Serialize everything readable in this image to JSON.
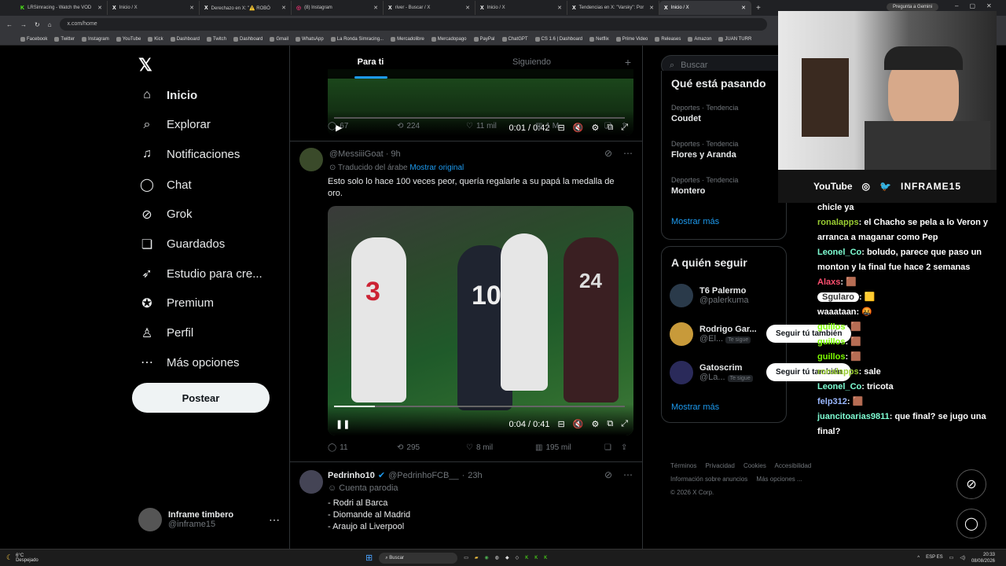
{
  "browser": {
    "tabs": [
      {
        "label": "LRSimracing - Watch the VOD",
        "icon": "K",
        "color": "#53fc18",
        "active": false
      },
      {
        "label": "Inicio / X",
        "icon": "X",
        "color": "#fff",
        "active": false
      },
      {
        "label": "Derechazo en X: \"⚠️ ROBÓ",
        "icon": "X",
        "color": "#fff",
        "active": false
      },
      {
        "label": "(8) Instagram",
        "icon": "◎",
        "color": "#e1306c",
        "active": false
      },
      {
        "label": "river - Buscar / X",
        "icon": "X",
        "color": "#fff",
        "active": false
      },
      {
        "label": "Inicio / X",
        "icon": "X",
        "color": "#fff",
        "active": false
      },
      {
        "label": "Tendencias en X: \"Varsky\": Por",
        "icon": "X",
        "color": "#fff",
        "active": false
      },
      {
        "label": "Inicio / X",
        "icon": "X",
        "color": "#fff",
        "active": true
      }
    ],
    "gemini": "Pregunta a Gemini",
    "url": "x.com/home",
    "bookmarks": [
      "Facebook",
      "Twitter",
      "Instagram",
      "YouTube",
      "Kick",
      "Dashboard",
      "Twitch",
      "Dashboard",
      "Gmail",
      "WhatsApp",
      "La Ronda Simracing...",
      "Mercadolibre",
      "Mercadopago",
      "PayPal",
      "ChatGPT",
      "CS 1.6 | Dashboard",
      "Netflix",
      "Prime Video",
      "Releases",
      "Amazon",
      "JUAN TURR"
    ]
  },
  "nav": {
    "items": [
      {
        "label": "Inicio",
        "icon": "⌂",
        "name": "home",
        "bold": true
      },
      {
        "label": "Explorar",
        "icon": "⌕",
        "name": "explore"
      },
      {
        "label": "Notificaciones",
        "icon": "♫",
        "name": "notifications"
      },
      {
        "label": "Chat",
        "icon": "◯",
        "name": "chat"
      },
      {
        "label": "Grok",
        "icon": "⊘",
        "name": "grok"
      },
      {
        "label": "Guardados",
        "icon": "❏",
        "name": "bookmarks"
      },
      {
        "label": "Estudio para cre...",
        "icon": "➶",
        "name": "creator-studio"
      },
      {
        "label": "Premium",
        "icon": "✪",
        "name": "premium"
      },
      {
        "label": "Perfil",
        "icon": "♙",
        "name": "profile"
      },
      {
        "label": "Más opciones",
        "icon": "⋯",
        "name": "more"
      }
    ],
    "post_label": "Postear",
    "account": {
      "name": "Inframe timbero",
      "handle": "@inframe15"
    }
  },
  "feed": {
    "tabs": [
      "Para ti",
      "Siguiendo"
    ],
    "tweet1": {
      "video_time": "0:01 / 0:42",
      "replies": "67",
      "reposts": "224",
      "likes": "11 mil",
      "views": "1 M"
    },
    "tweet2": {
      "handle": "@MessiiiGoat",
      "time": "9h",
      "translated": "Traducido del árabe",
      "show_original": "Mostrar original",
      "text": "Esto solo lo hace 100 veces peor, quería regalarle a su papá la medalla de oro.",
      "video_time": "0:04 / 0:41",
      "replies": "11",
      "reposts": "295",
      "likes": "8 mil",
      "views": "195 mil"
    },
    "tweet3": {
      "name": "Pedrinho10",
      "handle": "@PedrinhoFCB__",
      "time": "23h",
      "badge": "Cuenta parodia",
      "lines": [
        "- Rodri al Barca",
        "- Diomande al Madrid",
        "- Araujo al Liverpool"
      ]
    }
  },
  "right": {
    "search_placeholder": "Buscar",
    "trends_title": "Qué está pasando",
    "trends": [
      {
        "cat": "Deportes · Tendencia",
        "name": "Coudet"
      },
      {
        "cat": "Deportes · Tendencia",
        "name": "Flores y Aranda"
      },
      {
        "cat": "Deportes · Tendencia",
        "name": "Montero"
      }
    ],
    "show_more": "Mostrar más",
    "wtf_title": "A quién seguir",
    "wtf": [
      {
        "name": "T6 Palermo",
        "handle": "@palerkuma",
        "follows_you": ""
      },
      {
        "name": "Rodrigo Gar...",
        "handle": "@El...",
        "follows_you": "Te sigue",
        "button": "Seguir tú también"
      },
      {
        "name": "Gatoscrim",
        "handle": "@La...",
        "follows_you": "Te sigue",
        "button": "Seguir tú también"
      }
    ],
    "footer": [
      "Términos",
      "Privacidad",
      "Cookies",
      "Accesibilidad",
      "Información sobre anuncios",
      "Más opciones ...",
      "© 2026 X Corp."
    ]
  },
  "stream": {
    "socials": [
      "YouTube",
      "◎",
      "🐦",
      "INFRAME15"
    ],
    "chat": [
      {
        "user": "",
        "msg": "chicle ya",
        "color": "#fff"
      },
      {
        "user": "ronalapps",
        "msg": ": el Chacho se pela a lo Veron y arranca a maganar como Pep",
        "color": "#9acd32"
      },
      {
        "user": "Leonel_Co",
        "msg": ": boludo, parece que paso un monton y la final fue hace 2 semanas",
        "color": "#7fffd4"
      },
      {
        "user": "Alaxs",
        "msg": ": 🟫",
        "color": "#ff4f6f"
      },
      {
        "user": "Sgularo",
        "msg": ": 🟨",
        "color": "#333"
      },
      {
        "user": "waaataan",
        "msg": ": 🤬",
        "color": "#fff"
      },
      {
        "user": "guillos",
        "msg": ": 🟫",
        "color": "#7cfc00"
      },
      {
        "user": "guillos",
        "msg": ": 🟫",
        "color": "#7cfc00"
      },
      {
        "user": "guillos",
        "msg": ": 🟫",
        "color": "#7cfc00"
      },
      {
        "user": "ronalapps",
        "msg": ": sale",
        "color": "#9acd32"
      },
      {
        "user": "Leonel_Co",
        "msg": ": tricota",
        "color": "#7fffd4"
      },
      {
        "user": "felp312",
        "msg": ": 🟫",
        "color": "#9ab8ff"
      },
      {
        "user": "juancitoarias9811",
        "msg": ": que final? se jugo una final?",
        "color": "#7fffd4"
      }
    ]
  },
  "taskbar": {
    "weather_temp": "6°C",
    "weather_desc": "Despejado",
    "search": "Buscar",
    "lang": "ESP ES",
    "time": "20:33",
    "date": "08/08/2026"
  }
}
